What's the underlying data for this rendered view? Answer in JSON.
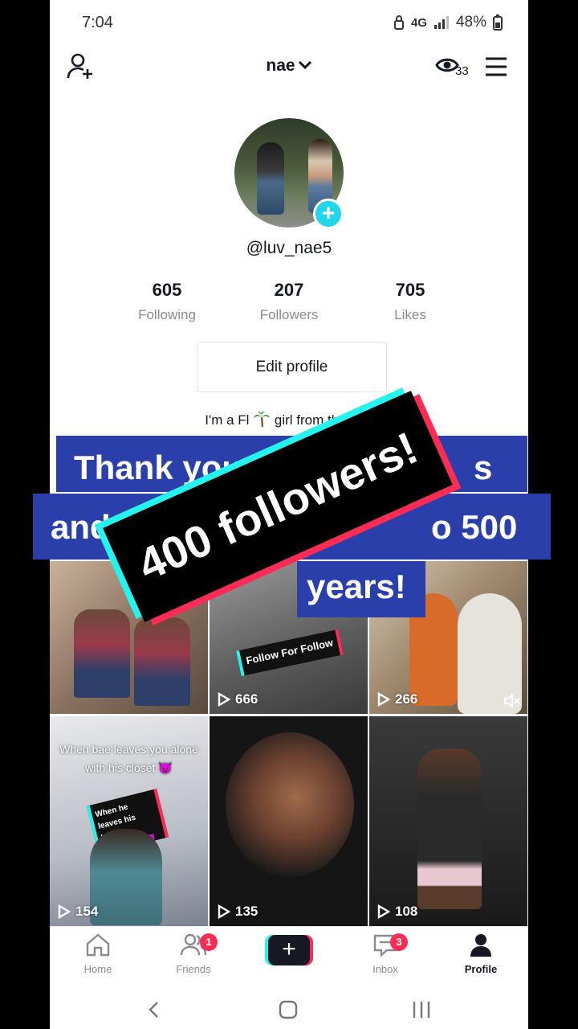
{
  "status": {
    "time": "7:04",
    "network": "4G",
    "battery": "48%"
  },
  "header": {
    "username": "nae",
    "profile_views": "33"
  },
  "profile": {
    "handle": "@luv_nae5",
    "stats": [
      {
        "value": "605",
        "label": "Following"
      },
      {
        "value": "207",
        "label": "Followers"
      },
      {
        "value": "705",
        "label": "Likes"
      }
    ],
    "edit_label": "Edit profile",
    "bio_prefix": "I'm a Fl",
    "bio_suffix": "girl from the 352"
  },
  "overlay": {
    "line1": "Thank you f",
    "line1_end": "s",
    "line2": "and r",
    "line2_end": "o 500",
    "line3": "years!",
    "tilted": "400 followers!"
  },
  "videos": [
    {
      "views": "",
      "caption": ""
    },
    {
      "views": "666",
      "caption": "Follow For Follow"
    },
    {
      "views": "266",
      "caption": ""
    },
    {
      "views": "154",
      "caption": "When bae leaves you alone with his closet 😈",
      "sticker": "When he leaves his hoodies unattended😈"
    },
    {
      "views": "135",
      "caption": ""
    },
    {
      "views": "108",
      "caption": ""
    }
  ],
  "nav": {
    "home": "Home",
    "friends": "Friends",
    "friends_badge": "1",
    "inbox": "Inbox",
    "inbox_badge": "3",
    "profile": "Profile"
  },
  "colors": {
    "cyan": "#25f4ee",
    "red": "#fe2c55",
    "banner": "#2b3fab"
  }
}
